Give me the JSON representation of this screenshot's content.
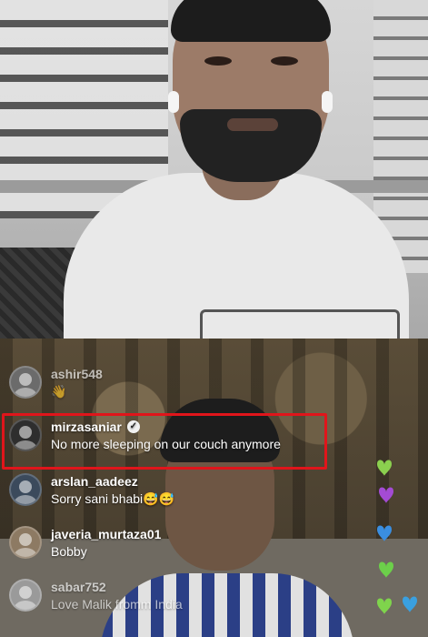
{
  "comments": [
    {
      "username": "ashir548",
      "message": "👋",
      "verified": false
    },
    {
      "username": "mirzasaniar",
      "message": "No more sleeping on our couch anymore",
      "verified": true
    },
    {
      "username": "arslan_aadeez",
      "message": "Sorry sani bhabi😅😅",
      "verified": false
    },
    {
      "username": "javeria_murtaza01",
      "message": "Bobby",
      "verified": false
    },
    {
      "username": "sabar752",
      "message": "Love Malik fromm India",
      "verified": false
    }
  ],
  "hearts": [
    {
      "color": "#8bd04f"
    },
    {
      "color": "#a44bd4"
    },
    {
      "color": "#3a8ee0"
    },
    {
      "color": "#6ccf4a"
    },
    {
      "color": "#3aa0e0"
    },
    {
      "color": "#7fd44c"
    }
  ],
  "colors": {
    "highlight": "#e0151b"
  }
}
